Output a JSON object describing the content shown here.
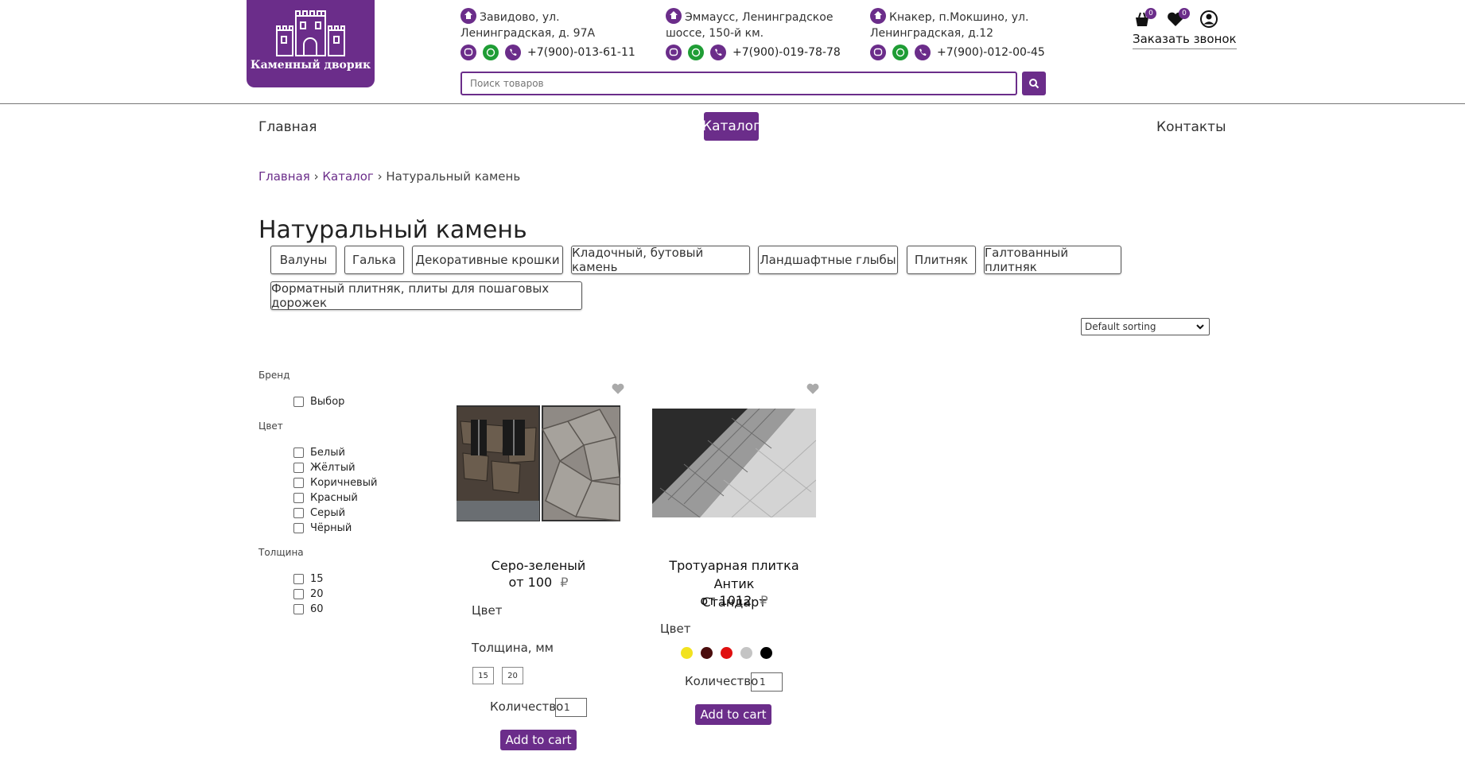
{
  "logo": {
    "text": "Каменный дворик"
  },
  "addresses": [
    {
      "text": "Завидово, ул. Ленинградская, д. 97А",
      "phone": "+7(900)-013-61-11"
    },
    {
      "text": "Эммаусс, Ленинградское шоссе, 150-й км.",
      "phone": "+7(900)-019-78-78"
    },
    {
      "text": "Кнакер, п.Мокшино, ул. Ленинградская, д.12",
      "phone": "+7(900)-012-00-45"
    }
  ],
  "search": {
    "placeholder": "Поиск товаров"
  },
  "header": {
    "cart_count": "0",
    "wishlist_count": "0",
    "callback_label": "Заказать звонок"
  },
  "nav": {
    "home": "Главная",
    "catalog": "Каталог",
    "contacts": "Контакты"
  },
  "breadcrumb": {
    "home": "Главная",
    "sep": "›",
    "catalog": "Каталог",
    "current": "Натуральный камень"
  },
  "page_title": "Натуральный камень",
  "categories": [
    "Валуны",
    "Галька",
    "Декоративные крошки",
    "Кладочный, бутовый камень",
    "Ландшафтные глыбы",
    "Плитняк",
    "Галтованный плитняк",
    "Форматный плитняк, плиты для пошаговых дорожек"
  ],
  "sorting": {
    "selected": "Default sorting"
  },
  "filters": {
    "brand": {
      "title": "Бренд",
      "options": [
        "Выбор"
      ]
    },
    "color": {
      "title": "Цвет",
      "options": [
        "Белый",
        "Жёлтый",
        "Коричневый",
        "Красный",
        "Серый",
        "Чёрный"
      ]
    },
    "thickness": {
      "title": "Толщина",
      "options": [
        "15",
        "20",
        "60"
      ]
    }
  },
  "products": [
    {
      "name": "Серо-зеленый",
      "price": "от 100",
      "currency": "₽",
      "color_label": "Цвет",
      "thickness_label": "Толщина, мм",
      "sizes": [
        "15",
        "20"
      ],
      "qty_label": "Количество",
      "qty": "1",
      "add_label": "Add to cart"
    },
    {
      "name_line1": "Тротуарная плитка Антик",
      "name_line2": "Стандарт",
      "price": "от 1012",
      "currency": "₽",
      "color_label": "Цвет",
      "swatches": [
        "#f2e21f",
        "#4a0d0d",
        "#e01010",
        "#c4c4c4",
        "#000000"
      ],
      "qty_label": "Количество",
      "qty": "1",
      "add_label": "Add to cart"
    }
  ],
  "colors": {
    "accent": "#6b2d8a",
    "whatsapp": "#1f9d35"
  }
}
